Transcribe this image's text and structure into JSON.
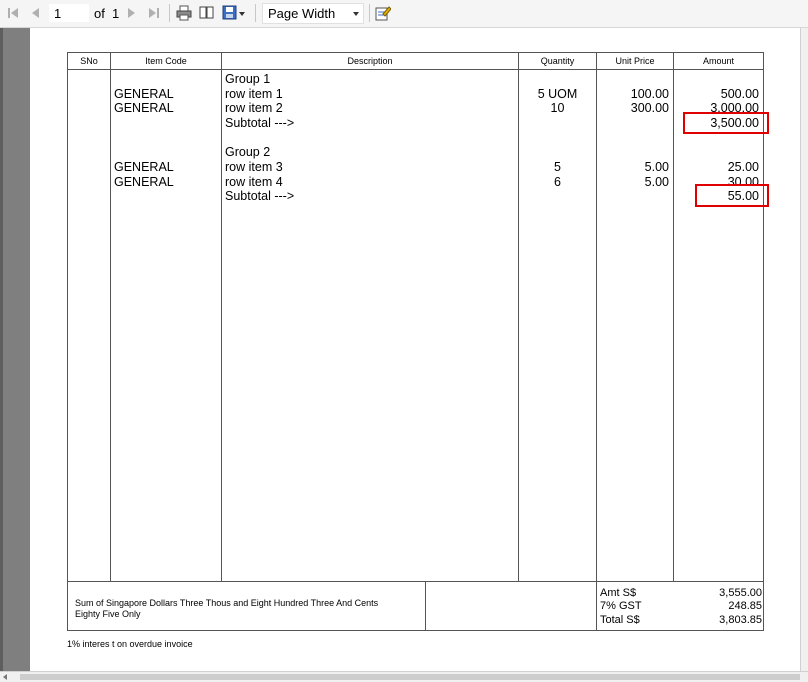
{
  "toolbar": {
    "page_current": "1",
    "of_label": "of",
    "page_total": "1",
    "zoom_value": "Page Width",
    "icons": [
      "first-page-icon",
      "previous-page-icon",
      "next-page-icon",
      "last-page-icon",
      "print-icon",
      "page-setup-icon",
      "export-icon",
      "edit-icon"
    ]
  },
  "report": {
    "columns": [
      "SNo",
      "Item Code",
      "Description",
      "Quantity",
      "Unit Price",
      "Amount"
    ],
    "groups": [
      {
        "title": "Group 1",
        "rows": [
          {
            "code": "GENERAL",
            "description": "row item 1",
            "quantity": "5 UOM",
            "unit_price": "100.00",
            "amount": "500.00"
          },
          {
            "code": "GENERAL",
            "description": "row item 2",
            "quantity": "10",
            "unit_price": "300.00",
            "amount": "3,000.00"
          }
        ],
        "subtotal_label": "Subtotal --->",
        "subtotal": "3,500.00"
      },
      {
        "title": "Group 2",
        "rows": [
          {
            "code": "GENERAL",
            "description": "row item 3",
            "quantity": "5",
            "unit_price": "5.00",
            "amount": "25.00"
          },
          {
            "code": "GENERAL",
            "description": "row item 4",
            "quantity": "6",
            "unit_price": "5.00",
            "amount": "30.00"
          }
        ],
        "subtotal_label": "Subtotal --->",
        "subtotal": "55.00"
      }
    ],
    "amount_in_words_line1": "Sum of Singapore Dollars Three Thous and Eight Hundred Three And Cents",
    "amount_in_words_line2": "Eighty Five Only",
    "totals": [
      {
        "label": "Amt S$",
        "value": "3,555.00"
      },
      {
        "label": "7% GST",
        "value": "248.85"
      },
      {
        "label": "Total S$",
        "value": "3,803.85"
      }
    ],
    "footer_note": "1% interes t on overdue invoice"
  },
  "colors": {
    "highlight": "#e00000",
    "toolbar_bg": "#f5f5f5",
    "viewer_gray": "#7f7f7f"
  }
}
